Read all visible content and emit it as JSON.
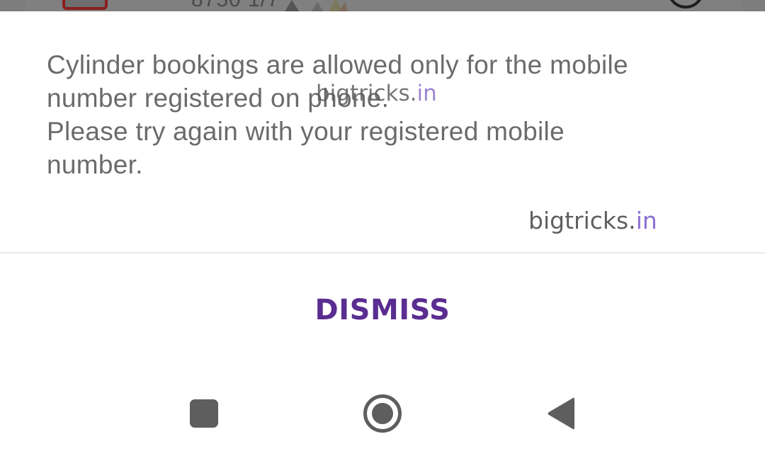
{
  "background_app": {
    "phone_fragment": "8750 1/7",
    "upi_icon": "upi-logo-icon",
    "app_logo_icon": "app-logo-icon",
    "profile_icon": "circle-icon"
  },
  "dialog": {
    "message_lines": [
      "Cylinder bookings are allowed only for the mobile",
      "number registered on phone.",
      "Please try again with your registered mobile",
      "number."
    ],
    "dismiss_label": "DISMISS",
    "dismiss_color": "#5a2d91",
    "text_color": "#6b6b6b"
  },
  "watermarks": {
    "center": {
      "main": "bigtricks.",
      "tld": "in"
    },
    "right": {
      "main": "bigtricks.",
      "tld": "in"
    },
    "tld_color": "#8b6fd1"
  },
  "nav_bar": {
    "recents_icon": "square-recents-icon",
    "home_icon": "circle-home-icon",
    "back_icon": "triangle-back-icon"
  }
}
